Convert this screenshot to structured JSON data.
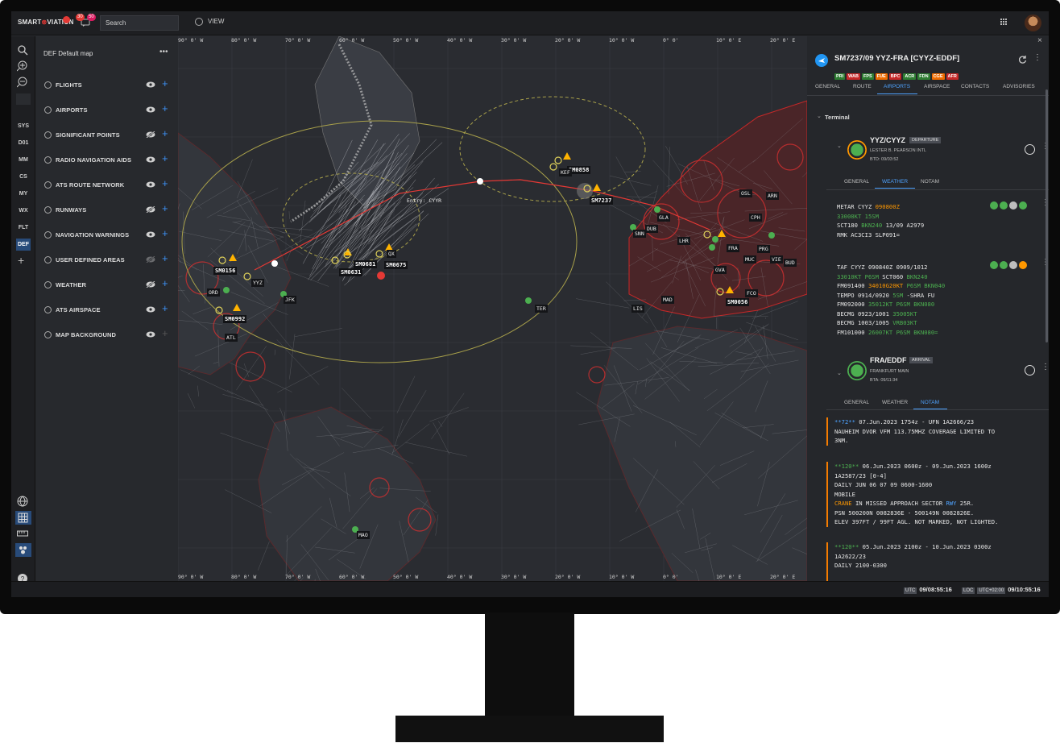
{
  "app": {
    "logo_left": "SMART",
    "logo_mark": "⊗",
    "logo_right": "VIATION",
    "badge_alerts": "",
    "badge_red": "30",
    "badge_pink": "50"
  },
  "toolbar": {
    "search_placeholder": "Search",
    "view_label": "VIEW"
  },
  "rail": {
    "items": [
      "SYS",
      "D01",
      "MM",
      "CS",
      "MY",
      "WX",
      "FLT",
      "DEF"
    ],
    "active": "DEF"
  },
  "layers": {
    "title": "DEF Default map",
    "items": [
      {
        "label": "FLIGHTS",
        "icon": "flight-icon",
        "visible": true
      },
      {
        "label": "AIRPORTS",
        "icon": "airport-icon",
        "visible": true
      },
      {
        "label": "SIGNIFICANT POINTS",
        "icon": "points-icon",
        "visible": false
      },
      {
        "label": "RADIO NAVIGATION AIDS",
        "icon": "radio-icon",
        "visible": true
      },
      {
        "label": "ATS ROUTE NETWORK",
        "icon": "route-icon",
        "visible": true
      },
      {
        "label": "RUNWAYS",
        "icon": "runway-icon",
        "visible": false
      },
      {
        "label": "NAVIGATION WARNINGS",
        "icon": "warning-icon",
        "visible": true
      },
      {
        "label": "USER DEFINED AREAS",
        "icon": "area-icon",
        "visible": false
      },
      {
        "label": "WEATHER",
        "icon": "weather-icon",
        "visible": false
      },
      {
        "label": "ATS AIRSPACE",
        "icon": "airspace-icon",
        "visible": true
      },
      {
        "label": "MAP BACKGROUND",
        "icon": "background-icon",
        "visible": true
      }
    ]
  },
  "map": {
    "top_ticks": [
      "90° 0' W",
      "80° 0' W",
      "70° 0' W",
      "60° 0' W",
      "50° 0' W",
      "40° 0' W",
      "30° 0' W",
      "20° 0' W",
      "10° 0' W",
      "0° 0'",
      "10° 0' E",
      "20° 0' E"
    ],
    "bottom_ticks": [
      "90° 0' W",
      "80° 0' W",
      "70° 0' W",
      "60° 0' W",
      "50° 0' W",
      "40° 0' W",
      "30° 0' W",
      "20° 0' W",
      "10° 0' W",
      "0° 0'",
      "10° 0' E",
      "20° 0' E"
    ],
    "flights": [
      "SM0156",
      "SM0681",
      "SM0675",
      "SM0631",
      "SM0992",
      "SM0858",
      "SM7237",
      "SM0056"
    ],
    "airports": [
      "YYZ",
      "ORD",
      "JFK",
      "ATL",
      "KEF",
      "TER",
      "GLA",
      "DUB",
      "SNN",
      "LHR",
      "FRA",
      "OSL",
      "ARN",
      "CPH",
      "PRG",
      "MUC",
      "VIE",
      "BUD",
      "GVA",
      "MAD",
      "LIS",
      "FCO",
      "MAO",
      "QX"
    ],
    "entry_label": "Entry: CYYR"
  },
  "flight": {
    "title": "SM7237/09 YYZ-FRA [CYYZ-EDDF]",
    "chips": [
      {
        "t": "PRI",
        "c": "#2e7d32"
      },
      {
        "t": "WAB",
        "c": "#c62828"
      },
      {
        "t": "FPS",
        "c": "#2e7d32"
      },
      {
        "t": "FUE",
        "c": "#ef6c00"
      },
      {
        "t": "BPC",
        "c": "#c62828"
      },
      {
        "t": "ACR",
        "c": "#2e7d32"
      },
      {
        "t": "FDN",
        "c": "#2e7d32"
      },
      {
        "t": "CGE",
        "c": "#ef6c00"
      },
      {
        "t": "AFR",
        "c": "#c62828"
      }
    ],
    "tabs": [
      "GENERAL",
      "ROUTE",
      "AIRPORTS",
      "AIRSPACE",
      "CONTACTS",
      "ADVISORIES"
    ],
    "active_tab": "AIRPORTS",
    "section": "Terminal",
    "departure": {
      "code": "YYZ/CYYZ",
      "tag": "DEPARTURE",
      "name": "LESTER B. PEARSON INTL",
      "time": "BTD: 09/03:52",
      "tabs": [
        "GENERAL",
        "WEATHER",
        "NOTAM"
      ],
      "active": "WEATHER"
    },
    "arrival": {
      "code": "FRA/EDDF",
      "tag": "ARRIVAL",
      "name": "FRANKFURT MAIN",
      "time": "BTA: 09/11:34",
      "tabs": [
        "GENERAL",
        "WEATHER",
        "NOTAM"
      ],
      "active": "NOTAM"
    }
  },
  "status": {
    "utc_label": "UTC",
    "utc_time": "09/08:55:16",
    "loc_label": "LOC",
    "loc_offset": "UTC+02:00",
    "loc_time": "09/10:55:16"
  }
}
